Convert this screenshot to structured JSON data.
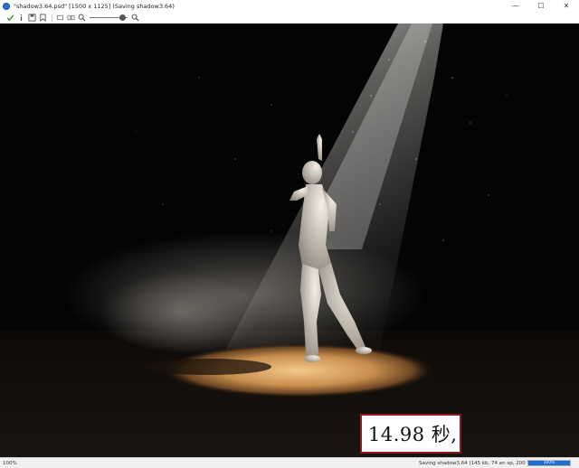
{
  "window": {
    "title": "\"shadow3.64.psd\" [1500 x 1125] (Saving shadow3.64)",
    "controls": {
      "minimize": "—",
      "maximize": "☐",
      "close": "✕"
    }
  },
  "toolbar": {
    "icons": [
      "check-icon",
      "info-icon",
      "save-icon",
      "bookmark-icon",
      "fit-icon",
      "compare-icon",
      "zoom-out-icon",
      "zoom-in-icon"
    ],
    "zoom_level": 0.85
  },
  "overlay": {
    "timer_text": "14.98 秒,"
  },
  "status": {
    "zoom": "100%",
    "saving_text": "Saving shadow3.64 (145 kb, 74 en sp, 200 )16 32)",
    "progress": 1.0,
    "progress_label": "100%"
  },
  "colors": {
    "accent": "#1f6fd0",
    "timer_border": "#8b1d22",
    "background": "#030303"
  }
}
